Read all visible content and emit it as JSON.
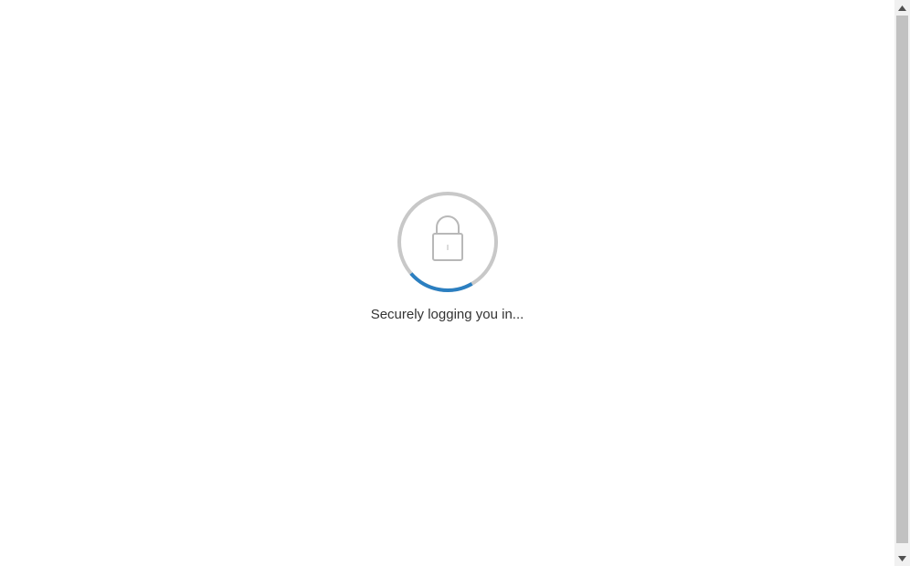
{
  "loading": {
    "status_text": "Securely logging you in...",
    "icon": "lock-icon",
    "spinner_icon": "progress-ring",
    "track_color": "#c8c8c8",
    "progress_color": "#2b7fc1",
    "progress_fraction": 0.22
  },
  "scrollbar": {
    "up_icon": "triangle-up-icon",
    "down_icon": "triangle-down-icon"
  }
}
